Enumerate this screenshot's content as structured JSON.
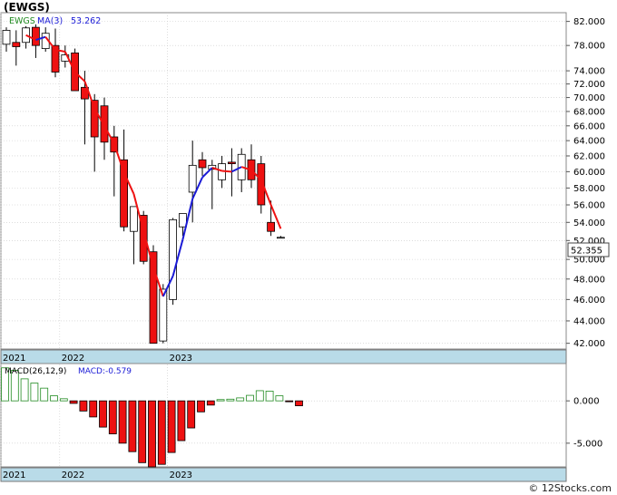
{
  "ticker": "(EWGS)",
  "credit": "© 12Stocks.com",
  "colors": {
    "up_candle": "#ffffff",
    "down_candle": "#ee1111",
    "ma_up": "#1a1ad6",
    "ma_down": "#ee1111",
    "legend_green": "#228b22",
    "legend_blue": "#1a1ad6",
    "axis_strip": "#b9dbe8",
    "grid": "#c8c8c8"
  },
  "chart_data": [
    {
      "type": "candlestick",
      "title": "",
      "legend": {
        "symbol": "EWGS",
        "ma_label": "MA(3)",
        "ma_value": "53.262"
      },
      "last_price": "52.355",
      "x_labels": [
        "2021",
        "2022",
        "2023"
      ],
      "x_label_index": [
        0,
        6,
        17
      ],
      "y_ticks": [
        "82.000",
        "78.000",
        "74.000",
        "72.000",
        "70.000",
        "68.000",
        "66.000",
        "64.000",
        "62.000",
        "60.000",
        "58.000",
        "56.000",
        "54.000",
        "52.000",
        "50.000",
        "48.000",
        "46.000",
        "44.000",
        "42.000"
      ],
      "y_tick_values": [
        82,
        78,
        74,
        72,
        70,
        68,
        66,
        64,
        62,
        60,
        58,
        56,
        54,
        52,
        50,
        48,
        46,
        44,
        42
      ],
      "y_scale": "log",
      "ylim": [
        41.5,
        83.5
      ],
      "ohlc": [
        [
          78.2,
          81.0,
          77.0,
          80.5
        ],
        [
          78.5,
          80.5,
          74.8,
          77.8
        ],
        [
          78.5,
          81.2,
          77.5,
          80.9
        ],
        [
          81.0,
          81.5,
          76.0,
          78.0
        ],
        [
          77.5,
          81.0,
          77.0,
          80.0
        ],
        [
          78.0,
          80.8,
          73.0,
          73.8
        ],
        [
          75.5,
          78.0,
          74.5,
          76.5
        ],
        [
          76.8,
          77.5,
          72.5,
          71.0
        ],
        [
          71.5,
          74.0,
          63.5,
          69.8
        ],
        [
          69.6,
          70.5,
          60.0,
          64.5
        ],
        [
          68.8,
          70.0,
          61.5,
          63.8
        ],
        [
          64.5,
          66.0,
          57.0,
          62.5
        ],
        [
          61.5,
          65.5,
          53.0,
          53.5
        ],
        [
          53.0,
          55.0,
          49.5,
          55.8
        ],
        [
          54.8,
          55.3,
          49.5,
          49.8
        ],
        [
          50.8,
          51.5,
          42.0,
          42.0
        ],
        [
          42.2,
          47.5,
          42.0,
          47.0
        ],
        [
          46.0,
          54.5,
          45.5,
          54.3
        ],
        [
          53.5,
          55.0,
          52.5,
          55.0
        ],
        [
          57.5,
          64.0,
          54.0,
          60.8
        ],
        [
          61.5,
          62.5,
          59.5,
          60.5
        ],
        [
          60.3,
          61.5,
          55.5,
          60.8
        ],
        [
          59.0,
          62.0,
          58.0,
          61.0
        ],
        [
          61.2,
          63.0,
          57.0,
          61.0
        ],
        [
          59.0,
          63.0,
          57.5,
          62.2
        ],
        [
          61.5,
          63.5,
          58.0,
          59.0
        ],
        [
          61.0,
          62.0,
          55.0,
          56.0
        ],
        [
          54.0,
          56.5,
          52.5,
          53.0
        ],
        [
          52.35,
          52.5,
          52.3,
          52.35
        ]
      ],
      "ma3": [
        null,
        null,
        79.7,
        78.9,
        79.4,
        77.3,
        77.0,
        73.8,
        72.4,
        68.4,
        66.0,
        63.6,
        59.9,
        57.3,
        53.0,
        49.2,
        46.3,
        48.3,
        52.1,
        56.7,
        59.3,
        60.5,
        60.1,
        60.0,
        60.6,
        60.2,
        59.0,
        56.0,
        53.3
      ]
    },
    {
      "type": "bar",
      "title": "",
      "legend": {
        "label": "MACD(26,12,9)",
        "value_label": "MACD:-0.579"
      },
      "y_ticks": [
        "0.000",
        "-5.000"
      ],
      "y_tick_values": [
        0,
        -5
      ],
      "ylim": [
        -7.8,
        4.3
      ],
      "x_labels": [
        "2021",
        "2022",
        "2023"
      ],
      "x_label_index": [
        0,
        6,
        17
      ],
      "values": [
        3.9,
        3.6,
        2.6,
        2.1,
        1.5,
        0.6,
        0.25,
        -0.3,
        -1.2,
        -1.9,
        -3.1,
        -3.9,
        -5.0,
        -6.0,
        -7.3,
        -7.8,
        -7.5,
        -6.1,
        -4.7,
        -3.2,
        -1.3,
        -0.5,
        0.15,
        0.2,
        0.35,
        0.65,
        1.2,
        1.15,
        0.6,
        -0.1,
        -0.58
      ]
    }
  ]
}
